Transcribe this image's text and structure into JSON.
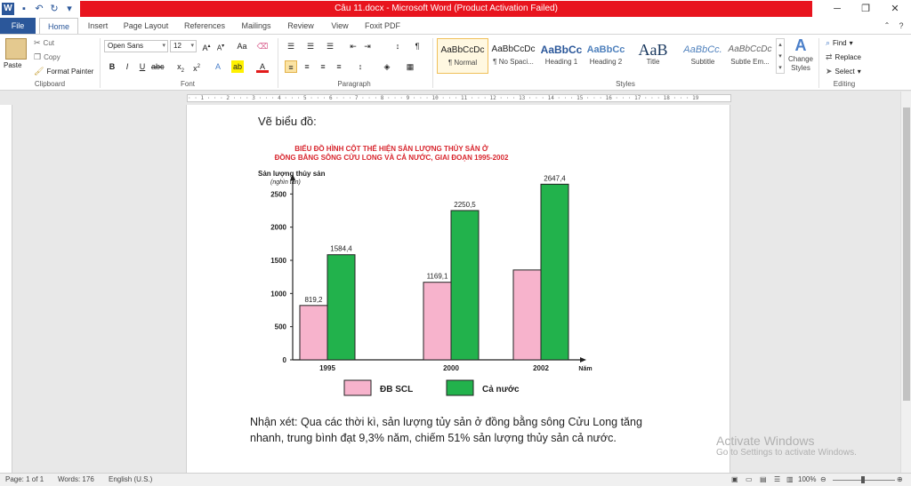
{
  "window": {
    "title": "Câu 11.docx  -  Microsoft Word (Product Activation Failed)",
    "logo_letter": "W"
  },
  "tabs": [
    "File",
    "Home",
    "Insert",
    "Page Layout",
    "References",
    "Mailings",
    "Review",
    "View",
    "Foxit PDF"
  ],
  "ribbon": {
    "clipboard": {
      "label": "Clipboard",
      "paste": "Paste",
      "cut": "Cut",
      "copy": "Copy",
      "format_painter": "Format Painter"
    },
    "font": {
      "label": "Font",
      "family": "Open Sans",
      "size": "12"
    },
    "paragraph": {
      "label": "Paragraph"
    },
    "styles": {
      "label": "Styles",
      "items": [
        {
          "preview": "AaBbCcDc",
          "name": "¶ Normal"
        },
        {
          "preview": "AaBbCcDc",
          "name": "¶ No Spaci..."
        },
        {
          "preview": "AaBbCc",
          "name": "Heading 1"
        },
        {
          "preview": "AaBbCc",
          "name": "Heading 2"
        },
        {
          "preview": "AaB",
          "name": "Title"
        },
        {
          "preview": "AaBbCc.",
          "name": "Subtitle"
        },
        {
          "preview": "AaBbCcDc",
          "name": "Subtle Em..."
        }
      ],
      "change_styles": "Change Styles"
    },
    "editing": {
      "label": "Editing",
      "find": "Find",
      "replace": "Replace",
      "select": "Select"
    }
  },
  "document": {
    "heading": "Vẽ biểu đồ:",
    "note": "Nhận xét: Qua các thời kì, sản lượng tủy sản ở đồng bằng sông Cửu Long tăng nhanh, trung bình đạt 9,3% năm, chiếm 51% sản lượng thủy sản cả nước."
  },
  "chart_data": {
    "type": "bar",
    "title": "BIỂU ĐỒ HÌNH CỘT THỂ HIỆN SẢN LƯỢNG THỦY SẢN Ở ĐỒNG BẰNG SÔNG CỬU LONG VÀ CẢ NƯỚC, GIAI ĐOẠN 1995-2002",
    "title_lines": [
      "BIỂU ĐỒ HÌNH CỘT THỂ HIỆN SẢN LƯỢNG THỦY SẢN Ở",
      "ĐỒNG BẰNG SÔNG CỬU LONG VÀ CẢ NƯỚC, GIAI ĐOẠN 1995-2002"
    ],
    "ylabel": "Sản lượng thủy sản",
    "yunit": "(nghìn tấn)",
    "xlabel": "Năm",
    "x": [
      1995,
      2000,
      2002
    ],
    "ylim": [
      0,
      2800
    ],
    "yticks": [
      0,
      500,
      1000,
      1500,
      2000,
      2500
    ],
    "series": [
      {
        "name": "ĐB SCL",
        "values": [
          819.2,
          1169.1,
          1354.5
        ],
        "labels": [
          "819,2",
          "1169,1",
          ""
        ],
        "color": "#f7b3cc"
      },
      {
        "name": "Cả nước",
        "values": [
          1584.4,
          2250.5,
          2647.4
        ],
        "labels": [
          "1584,4",
          "2250,5",
          "2647,4"
        ],
        "color": "#22b24c"
      }
    ],
    "title_color": "#d8262e",
    "legend_position": "bottom"
  },
  "status": {
    "page": "Page: 1 of 1",
    "words": "Words: 176",
    "language": "English (U.S.)",
    "zoom": "100%"
  },
  "watermark": {
    "line1": "Activate Windows",
    "line2": "Go to Settings to activate Windows."
  }
}
